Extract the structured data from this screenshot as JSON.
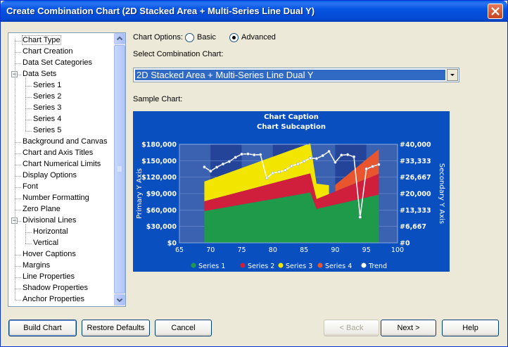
{
  "window": {
    "title": "Create Combination Chart (2D Stacked Area + Multi-Series Line Dual Y)"
  },
  "tree": {
    "items": [
      {
        "label": "Chart Type",
        "level": 0,
        "selected": true
      },
      {
        "label": "Chart Creation",
        "level": 0
      },
      {
        "label": "Data Set Categories",
        "level": 0
      },
      {
        "label": "Data Sets",
        "level": 0,
        "expander": "−"
      },
      {
        "label": "Series 1",
        "level": 1
      },
      {
        "label": "Series 2",
        "level": 1
      },
      {
        "label": "Series 3",
        "level": 1
      },
      {
        "label": "Series 4",
        "level": 1
      },
      {
        "label": "Series 5",
        "level": 1
      },
      {
        "label": "Background and Canvas",
        "level": 0
      },
      {
        "label": "Chart and Axis Titles",
        "level": 0
      },
      {
        "label": "Chart Numerical Limits",
        "level": 0
      },
      {
        "label": "Display Options",
        "level": 0
      },
      {
        "label": "Font",
        "level": 0
      },
      {
        "label": "Number Formatting",
        "level": 0
      },
      {
        "label": "Zero Plane",
        "level": 0
      },
      {
        "label": "Divisional Lines",
        "level": 0,
        "expander": "−"
      },
      {
        "label": "Horizontal",
        "level": 1
      },
      {
        "label": "Vertical",
        "level": 1
      },
      {
        "label": "Hover Captions",
        "level": 0
      },
      {
        "label": "Margins",
        "level": 0
      },
      {
        "label": "Line Properties",
        "level": 0
      },
      {
        "label": "Shadow Properties",
        "level": 0
      },
      {
        "label": "Anchor Properties",
        "level": 0
      }
    ]
  },
  "options": {
    "chart_options_label": "Chart Options:",
    "basic_label": "Basic",
    "advanced_label": "Advanced",
    "selected": "Advanced",
    "select_label": "Select Combination Chart:",
    "select_value": "2D Stacked Area + Multi-Series Line Dual Y",
    "sample_label": "Sample Chart:"
  },
  "chart_data": {
    "type": "area",
    "title": "Chart Caption",
    "subtitle": "Chart Subcaption",
    "xlabel": "",
    "ylabel": "Primary Y Axis",
    "y2label": "Secondary Y Axis",
    "xlim": [
      65,
      100
    ],
    "ylim": [
      0,
      180000
    ],
    "y2lim": [
      0,
      40000
    ],
    "x_ticks": [
      "65",
      "70",
      "75",
      "80",
      "85",
      "90",
      "95",
      "100"
    ],
    "y_ticks": [
      "$0",
      "$30,000",
      "$60,000",
      "$90,000",
      "$120,000",
      "$150,000",
      "$180,000"
    ],
    "y2_ticks": [
      "#0",
      "#6,667",
      "#13,333",
      "#20,000",
      "#26,667",
      "#33,333",
      "#40,000"
    ],
    "legend_position": "bottom",
    "colors": {
      "background": "#0a4fbf",
      "plot_band_light": "#3a62b0",
      "plot_band_dark": "#24449a",
      "Series 1": "#1f9a4a",
      "Series 2": "#d01f3c",
      "Series 3": "#f2e600",
      "Series 4": "#e8552e",
      "Trend": "#ffffff",
      "text": "#ffffff"
    },
    "series": [
      {
        "name": "Series 1",
        "axis": "primary",
        "x": [
          69,
          86,
          87,
          97
        ],
        "values": [
          58000,
          92000,
          62000,
          88000
        ]
      },
      {
        "name": "Series 2",
        "axis": "primary",
        "x": [
          69,
          86,
          87,
          97
        ],
        "values": [
          18000,
          35000,
          18000,
          38000
        ]
      },
      {
        "name": "Series 3",
        "axis": "primary",
        "x": [
          69,
          86,
          87,
          89
        ],
        "values": [
          36000,
          55000,
          28000,
          16000
        ]
      },
      {
        "name": "Series 4",
        "axis": "primary",
        "x": [
          90,
          97
        ],
        "values": [
          12000,
          45000
        ]
      },
      {
        "name": "Trend",
        "axis": "secondary",
        "x": [
          69,
          70,
          71,
          72,
          73,
          74,
          75,
          76,
          77,
          78,
          79,
          80,
          81,
          82,
          83,
          84,
          85,
          86,
          87,
          88,
          89,
          90,
          91,
          92,
          93,
          94,
          95,
          96,
          97
        ],
        "values": [
          30800,
          29100,
          30700,
          32000,
          33000,
          34700,
          36000,
          36100,
          35700,
          35800,
          26300,
          28300,
          28800,
          29500,
          31200,
          32000,
          33100,
          34400,
          34200,
          35400,
          37100,
          32700,
          35600,
          35800,
          34900,
          10400,
          30000,
          31000,
          31800
        ]
      }
    ]
  },
  "buttons": {
    "build": "Build Chart",
    "restore": "Restore Defaults",
    "cancel": "Cancel",
    "back": "< Back",
    "next": "Next >",
    "help": "Help"
  }
}
